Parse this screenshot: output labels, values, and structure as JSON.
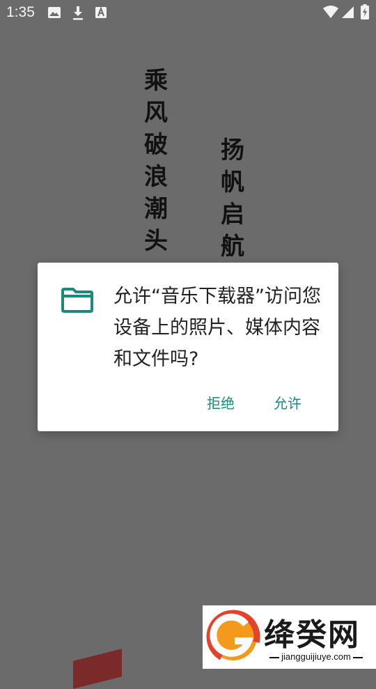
{
  "status_bar": {
    "time": "1:35",
    "left_icons": [
      "image-icon",
      "download-icon",
      "font-a-icon"
    ],
    "right_icons": [
      "wifi-icon",
      "signal-icon",
      "battery-charging-icon"
    ]
  },
  "splash": {
    "poem_col_1": [
      "乘",
      "风",
      "破",
      "浪",
      "潮",
      "头"
    ],
    "poem_col_2": [
      "扬",
      "帆",
      "启",
      "航"
    ]
  },
  "dialog": {
    "icon": "folder-icon",
    "message": "允许“音乐下载器”访问您设备上的照片、媒体内容和文件吗?",
    "deny_label": "拒绝",
    "allow_label": "允许",
    "accent_color": "#1a8a7e"
  },
  "watermark": {
    "title": "绛癸网",
    "url": "jiangguijiuye.com"
  }
}
